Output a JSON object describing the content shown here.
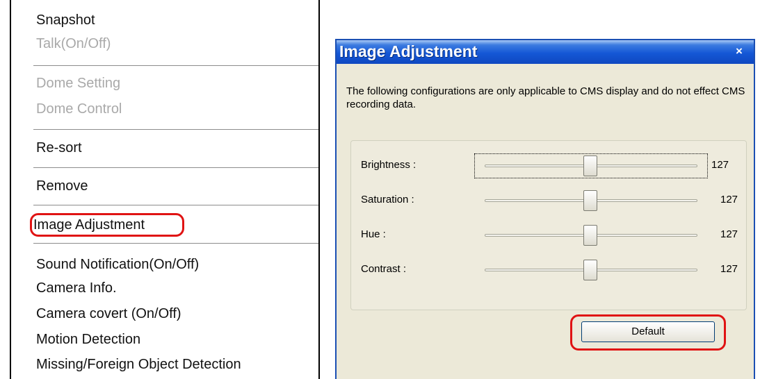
{
  "context_menu": {
    "items": [
      {
        "label": "Snapshot",
        "enabled": true
      },
      {
        "label": "Talk(On/Off)",
        "enabled": false
      },
      {
        "label": "Dome Setting",
        "enabled": false
      },
      {
        "label": "Dome Control",
        "enabled": false
      },
      {
        "label": "Re-sort",
        "enabled": true
      },
      {
        "label": "Remove",
        "enabled": true
      },
      {
        "label": "Image Adjustment",
        "enabled": true,
        "highlighted": true
      },
      {
        "label": "Sound Notification(On/Off)",
        "enabled": true
      },
      {
        "label": "Camera Info.",
        "enabled": true
      },
      {
        "label": "Camera covert (On/Off)",
        "enabled": true
      },
      {
        "label": "Motion Detection",
        "enabled": true
      },
      {
        "label": "Missing/Foreign Object Detection",
        "enabled": true
      }
    ]
  },
  "dialog": {
    "title": "Image Adjustment",
    "close_glyph": "×",
    "description": "The following configurations are only applicable to CMS display and do not effect CMS recording data.",
    "sliders": [
      {
        "label": "Brightness :",
        "value": "127",
        "level": 127,
        "max": 255,
        "focused": true
      },
      {
        "label": "Saturation :",
        "value": "127",
        "level": 127,
        "max": 255,
        "focused": false
      },
      {
        "label": "Hue :",
        "value": "127",
        "level": 127,
        "max": 255,
        "focused": false
      },
      {
        "label": "Contrast :",
        "value": "127",
        "level": 127,
        "max": 255,
        "focused": false
      }
    ],
    "default_button_label": "Default"
  },
  "colors": {
    "highlight": "#e01313",
    "titlebar": "#1457d6",
    "dialog_bg": "#ece9d8",
    "disabled_text": "#a9a9a9"
  }
}
